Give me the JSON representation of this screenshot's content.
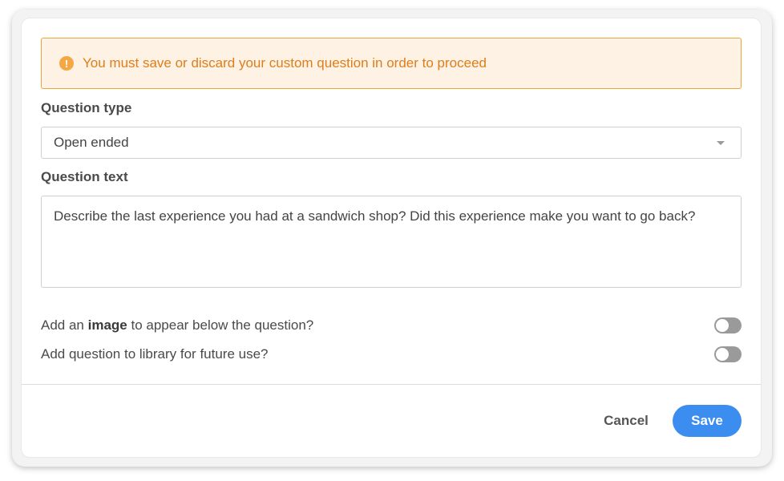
{
  "alert": {
    "icon": "exclamation-icon",
    "text": "You must save or discard your custom question in order to proceed"
  },
  "question_type": {
    "label": "Question type",
    "selected": "Open ended"
  },
  "question_text": {
    "label": "Question text",
    "value": "Describe the last experience you had at a sandwich shop? Did this experience make you want to go back?"
  },
  "options": {
    "image_prefix": "Add an ",
    "image_bold": "image",
    "image_suffix": " to appear below the question?",
    "library_label": "Add question to library for future use?",
    "image_toggle_on": false,
    "library_toggle_on": false
  },
  "footer": {
    "cancel_label": "Cancel",
    "save_label": "Save"
  },
  "colors": {
    "accent": "#3c8df0",
    "warning_border": "#f0a23b",
    "warning_text": "#e07d1a",
    "warning_bg": "#fdf2e3"
  }
}
